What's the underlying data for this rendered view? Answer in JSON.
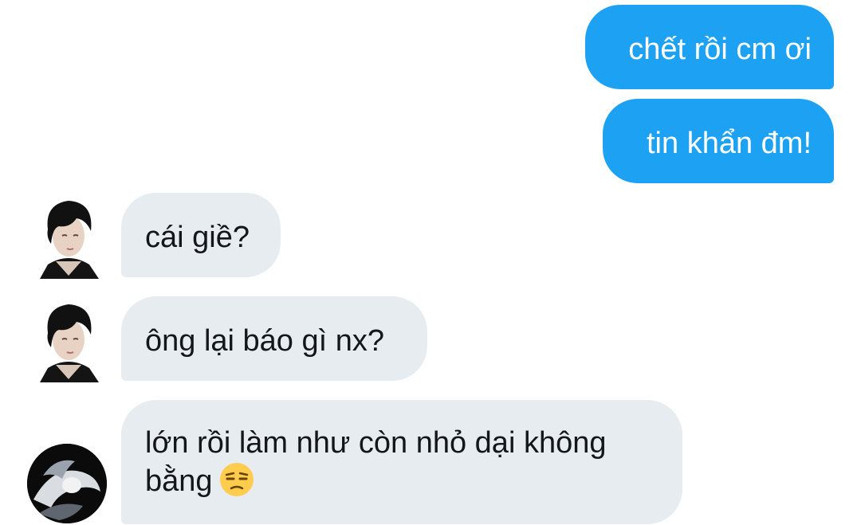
{
  "messages": {
    "sent": [
      {
        "text": "chết rồi cm ơi"
      },
      {
        "text": "tin khẩn đm!"
      }
    ],
    "received": [
      {
        "text": "cái giề?"
      },
      {
        "text": "ông lại báo gì nx?"
      },
      {
        "text": "lớn rồi làm như còn nhỏ dại không bằng",
        "emoji": "unamused-face-emoji"
      }
    ]
  },
  "colors": {
    "sent_bubble": "#1da1f2",
    "received_bubble": "#e6ecf0",
    "sent_text": "#ffffff",
    "received_text": "#14171a"
  }
}
